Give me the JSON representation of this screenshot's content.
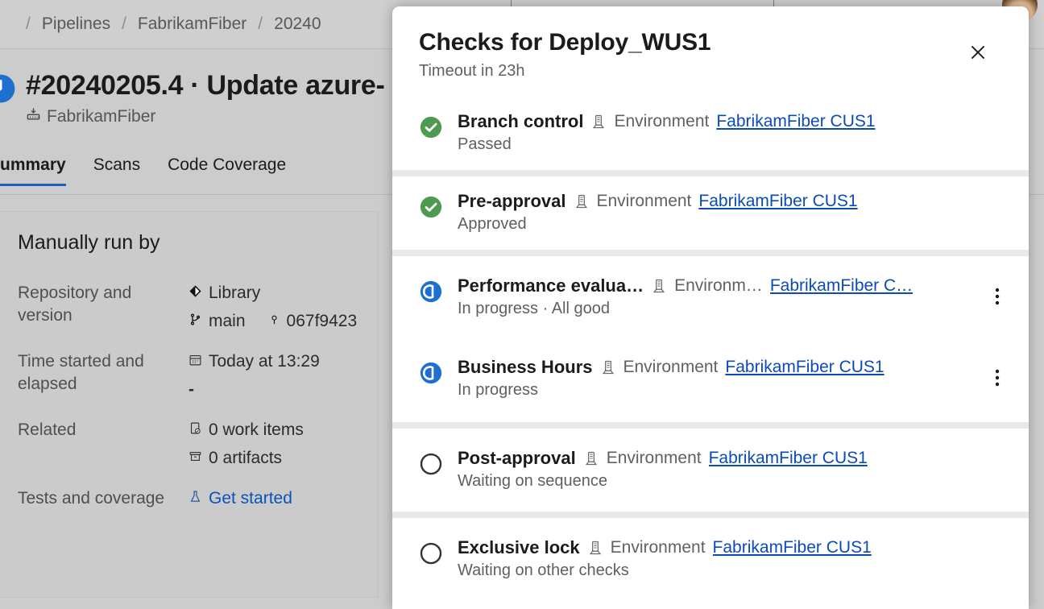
{
  "background": {
    "breadcrumb": {
      "separator": "/",
      "items": [
        "Pipelines",
        "FabrikamFiber",
        "20240"
      ]
    },
    "run": {
      "status_icon": "clock-icon",
      "title": "#20240205.4 · Update azure-",
      "project_icon": "pipeline-icon",
      "project": "FabrikamFiber"
    },
    "tabs": [
      {
        "label": "ummary",
        "active": true
      },
      {
        "label": "Scans",
        "active": false
      },
      {
        "label": "Code Coverage",
        "active": false
      }
    ],
    "details": {
      "card_title": "Manually run by",
      "rows": [
        {
          "label": "Repository and version",
          "lines": [
            {
              "icon": "repo-icon",
              "text": "Library",
              "link": false
            },
            {
              "icon": "branch-icon",
              "text": "main",
              "link": false,
              "extra_icon": "commit-icon",
              "extra_text": "067f9423"
            }
          ]
        },
        {
          "label": "Time started and elapsed",
          "lines": [
            {
              "icon": "calendar-icon",
              "text": "Today at 13:29",
              "link": false
            },
            {
              "icon": "",
              "text": "-",
              "link": false
            }
          ]
        },
        {
          "label": "Related",
          "lines": [
            {
              "icon": "work-item-icon",
              "text": "0 work items",
              "link": false
            },
            {
              "icon": "artifact-icon",
              "text": "0 artifacts",
              "link": false
            }
          ]
        },
        {
          "label": "Tests and coverage",
          "lines": [
            {
              "icon": "flask-icon",
              "text": "Get started",
              "link": true
            }
          ]
        }
      ]
    }
  },
  "dialog": {
    "title": "Checks for Deploy_WUS1",
    "subtitle": "Timeout in 23h",
    "close_icon": "close-icon",
    "groups": [
      {
        "checks": [
          {
            "status": "succeeded",
            "status_icon": "check-circle-icon",
            "name": "Branch control",
            "resource_icon": "environment-icon",
            "resource_type": "Environment",
            "resource_name": "FabrikamFiber CUS1",
            "sub_status": "Passed",
            "has_menu": false,
            "menu_icon": "more-vertical-icon"
          }
        ]
      },
      {
        "checks": [
          {
            "status": "succeeded",
            "status_icon": "check-circle-icon",
            "name": "Pre-approval",
            "resource_icon": "environment-icon",
            "resource_type": "Environment",
            "resource_name": "FabrikamFiber CUS1",
            "sub_status": "Approved",
            "has_menu": false,
            "menu_icon": "more-vertical-icon"
          }
        ]
      },
      {
        "checks": [
          {
            "status": "in-progress",
            "status_icon": "in-progress-icon",
            "name": "Performance evalua…",
            "resource_icon": "environment-icon",
            "resource_type": "Environm…",
            "resource_name": "FabrikamFiber C…",
            "sub_status": "In progress · All good",
            "has_menu": true,
            "menu_icon": "more-vertical-icon"
          },
          {
            "status": "in-progress",
            "status_icon": "in-progress-icon",
            "name": "Business Hours",
            "resource_icon": "environment-icon",
            "resource_type": "Environment",
            "resource_name": "FabrikamFiber CUS1",
            "sub_status": "In progress",
            "has_menu": true,
            "menu_icon": "more-vertical-icon"
          }
        ]
      },
      {
        "checks": [
          {
            "status": "waiting",
            "status_icon": "empty-circle-icon",
            "name": "Post-approval",
            "resource_icon": "environment-icon",
            "resource_type": "Environment",
            "resource_name": "FabrikamFiber CUS1",
            "sub_status": "Waiting on sequence",
            "has_menu": false,
            "menu_icon": "more-vertical-icon"
          }
        ]
      },
      {
        "checks": [
          {
            "status": "waiting",
            "status_icon": "empty-circle-icon",
            "name": "Exclusive lock",
            "resource_icon": "environment-icon",
            "resource_type": "Environment",
            "resource_name": "FabrikamFiber CUS1",
            "sub_status": "Waiting on other checks",
            "has_menu": false,
            "menu_icon": "more-vertical-icon"
          }
        ]
      }
    ]
  },
  "colors": {
    "success": "#4e9a51",
    "in_progress": "#1f6fd0",
    "link": "#0b4bb8",
    "accent": "#1761c3",
    "waiting_outline": "#333333"
  }
}
